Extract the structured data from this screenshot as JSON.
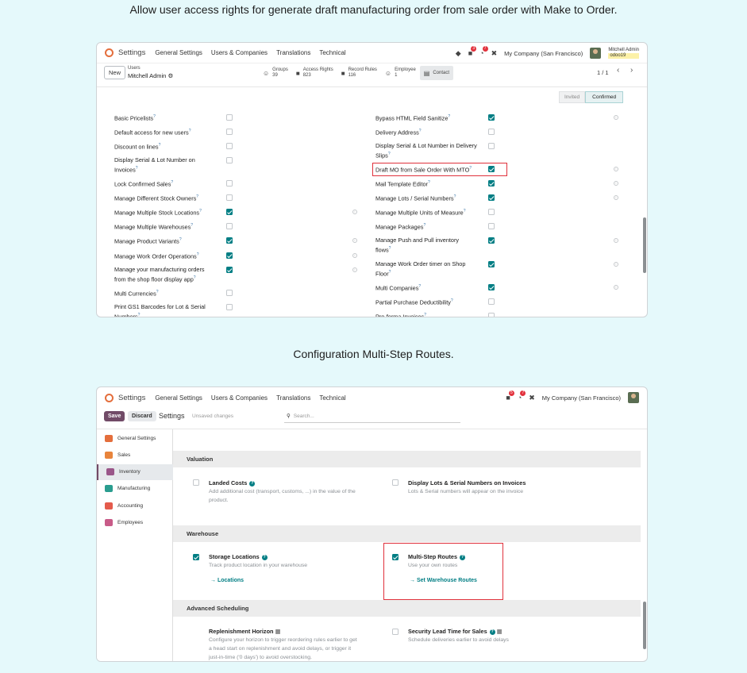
{
  "caption1": "Allow user access rights for generate draft manufacturing order from sale order with Make to Order.",
  "caption2": "Configuration Multi-Step Routes.",
  "colors": {
    "accent": "#017e84",
    "highlight": "#e0313c",
    "brand": "#714b67",
    "background": "#e5f9fb"
  },
  "shot1": {
    "nav": {
      "app": "Settings",
      "menu": [
        "General Settings",
        "Users & Companies",
        "Translations",
        "Technical"
      ],
      "badge_chat": "3",
      "badge_activity": "7",
      "company": "My Company (San Francisco)",
      "user_name": "Mitchell Admin",
      "user_db": "odoo19"
    },
    "control": {
      "new_label": "New",
      "breadcrumb_parent": "Users",
      "breadcrumb_current": "Mitchell Admin",
      "page_counter": "1 / 1"
    },
    "smart_buttons": [
      {
        "icon": "users-icon",
        "label": "Groups",
        "value": "39"
      },
      {
        "icon": "lock-icon",
        "label": "Access Rights",
        "value": "823"
      },
      {
        "icon": "lock-icon",
        "label": "Record Rules",
        "value": "116"
      },
      {
        "icon": "users-icon",
        "label": "Employee",
        "value": "1"
      },
      {
        "icon": "contact-card-icon",
        "label": "Contact",
        "value": ""
      }
    ],
    "status": {
      "invited": "Invited",
      "confirmed": "Confirmed"
    },
    "left_rights": [
      {
        "label": "Basic Pricelists",
        "help": "?",
        "checked": false,
        "info": false
      },
      {
        "label": "Default access for new users",
        "help": "?",
        "checked": false,
        "info": false
      },
      {
        "label": "Discount on lines",
        "help": "?",
        "checked": false,
        "info": false
      },
      {
        "label": "Display Serial & Lot Number on",
        "label2": "Invoices",
        "help": "?",
        "checked": false,
        "info": false
      },
      {
        "label": "Lock Confirmed Sales",
        "help": "?",
        "checked": false,
        "info": false
      },
      {
        "label": "Manage Different Stock Owners",
        "help": "?",
        "checked": false,
        "info": false
      },
      {
        "label": "Manage Multiple Stock Locations",
        "help": "?",
        "checked": true,
        "info": true
      },
      {
        "label": "Manage Multiple Warehouses",
        "help": "?",
        "checked": false,
        "info": false
      },
      {
        "label": "Manage Product Variants",
        "help": "?",
        "checked": true,
        "info": true
      },
      {
        "label": "Manage Work Order Operations",
        "help": "?",
        "checked": true,
        "info": true
      },
      {
        "label": "Manage your manufacturing orders",
        "label2": "from the shop floor display app",
        "help": "?",
        "checked": true,
        "info": true
      },
      {
        "label": "Multi Currencies",
        "help": "?",
        "checked": false,
        "info": false
      },
      {
        "label": "Print GS1 Barcodes for Lot & Serial",
        "label2": "Numbers",
        "help": "?",
        "checked": false,
        "info": false
      }
    ],
    "right_rights": [
      {
        "label": "Bypass HTML Field Sanitize",
        "help": "?",
        "checked": true,
        "info": true
      },
      {
        "label": "Delivery Address",
        "help": "?",
        "checked": false,
        "info": false
      },
      {
        "label": "Display Serial & Lot Number in Delivery",
        "label2": "Slips",
        "help": "?",
        "checked": false,
        "info": false
      },
      {
        "label": "Draft MO from Sale Order With MTO",
        "help": "?",
        "checked": true,
        "info": true
      },
      {
        "label": "Mail Template Editor",
        "help": "?",
        "checked": true,
        "info": true
      },
      {
        "label": "Manage Lots / Serial Numbers",
        "help": "?",
        "checked": true,
        "info": true
      },
      {
        "label": "Manage Multiple Units of Measure",
        "help": "?",
        "checked": false,
        "info": false
      },
      {
        "label": "Manage Packages",
        "help": "?",
        "checked": false,
        "info": false
      },
      {
        "label": "Manage Push and Pull inventory",
        "label2": "flows",
        "help": "?",
        "checked": true,
        "info": true
      },
      {
        "label": "Manage Work Order timer on Shop",
        "label2": "Floor",
        "help": "?",
        "checked": true,
        "info": true
      },
      {
        "label": "Multi Companies",
        "help": "?",
        "checked": true,
        "info": true
      },
      {
        "label": "Partial Purchase Deductibility",
        "help": "?",
        "checked": false,
        "info": false
      },
      {
        "label": "Pro-forma Invoices",
        "help": "?",
        "checked": false,
        "info": false
      }
    ]
  },
  "shot2": {
    "nav": {
      "app": "Settings",
      "menu": [
        "General Settings",
        "Users & Companies",
        "Translations",
        "Technical"
      ],
      "badge_chat": "5",
      "badge_activity": "7",
      "company": "My Company (San Francisco)"
    },
    "control": {
      "save": "Save",
      "discard": "Discard",
      "title": "Settings",
      "unsaved": "Unsaved changes",
      "search_placeholder": "Search..."
    },
    "sidebar": [
      {
        "label": "General Settings",
        "icon": "odoo-logo-icon",
        "color": "#e46e3c"
      },
      {
        "label": "Sales",
        "icon": "sales-chart-icon",
        "color": "#e8843c"
      },
      {
        "label": "Inventory",
        "icon": "inventory-box-icon",
        "color": "#9a5689"
      },
      {
        "label": "Manufacturing",
        "icon": "manufacturing-icon",
        "color": "#2a9d8f"
      },
      {
        "label": "Accounting",
        "icon": "accounting-icon",
        "color": "#e45b4c"
      },
      {
        "label": "Employees",
        "icon": "employees-icon",
        "color": "#c85b88"
      }
    ],
    "sections": {
      "valuation": "Valuation",
      "warehouse": "Warehouse",
      "advanced": "Advanced Scheduling"
    },
    "settings": {
      "landed_title": "Landed Costs",
      "landed_desc1": "Add additional cost (transport, customs, ...) in the value of the",
      "landed_desc2": "product.",
      "lots_title": "Display Lots & Serial Numbers on Invoices",
      "lots_desc": "Lots & Serial numbers will appear on the invoice",
      "storage_title": "Storage Locations",
      "storage_desc": "Track product location in your warehouse",
      "storage_link": "Locations",
      "multistep_title": "Multi-Step Routes",
      "multistep_desc": "Use your own routes",
      "multistep_link": "Set Warehouse Routes",
      "horizon_title": "Replenishment Horizon",
      "horizon_desc1": "Configure your horizon to trigger reordering rules earlier to get",
      "horizon_desc2": "a head start on replenishment and avoid delays, or trigger it",
      "horizon_desc3": "just-in-time ('0 days') to avoid overstocking.",
      "lead_title": "Security Lead Time for Sales",
      "lead_desc": "Schedule deliveries earlier to avoid delays"
    }
  }
}
